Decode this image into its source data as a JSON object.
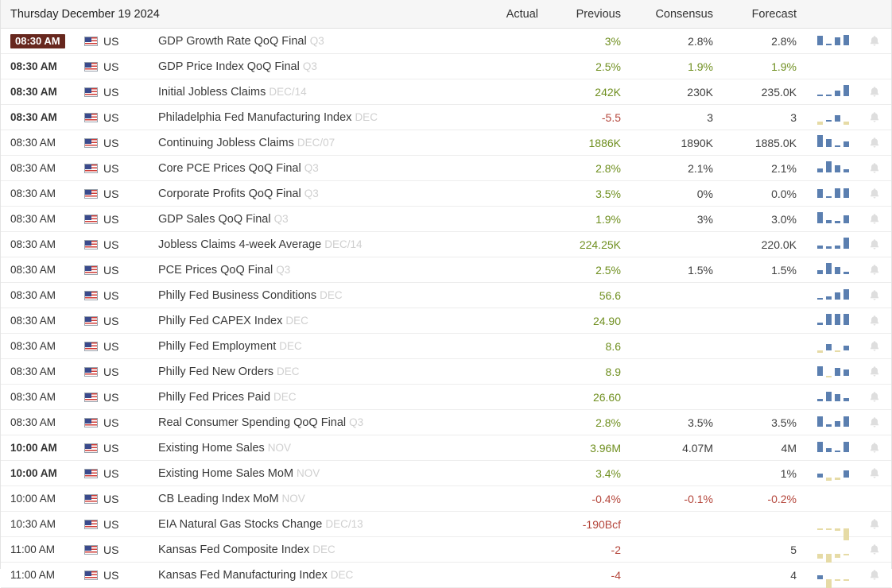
{
  "header": {
    "date": "Thursday December 19 2024",
    "columns": {
      "actual": "Actual",
      "previous": "Previous",
      "consensus": "Consensus",
      "forecast": "Forecast"
    }
  },
  "colors": {
    "positive": "#6f8f1f",
    "negative": "#b4453a",
    "neutral": "#3f3f3f",
    "period": "#cfcfcf",
    "badge_bg": "#67271e",
    "spark_up": "#5b7fb0",
    "spark_down": "#e6dba6",
    "header_bg": "#f6f6f6"
  },
  "icons": {
    "flag": "us-flag-icon",
    "bell": "bell-icon"
  },
  "country": "US",
  "rows": [
    {
      "time": "08:30 AM",
      "time_style": "badge",
      "country": "US",
      "event": "GDP Growth Rate QoQ Final",
      "period": "Q3",
      "actual": "",
      "previous": "3%",
      "consensus": "2.8%",
      "forecast": "2.8%",
      "previous_sign": "pos",
      "consensus_sign": "neu",
      "forecast_sign": "neu",
      "spark": [
        12,
        2,
        10,
        13
      ],
      "spark_dir": [
        "up",
        "up",
        "up",
        "up"
      ],
      "has_bell": true
    },
    {
      "time": "08:30 AM",
      "time_style": "bold",
      "country": "US",
      "event": "GDP Price Index QoQ Final",
      "period": "Q3",
      "actual": "",
      "previous": "2.5%",
      "consensus": "1.9%",
      "forecast": "1.9%",
      "previous_sign": "pos",
      "consensus_sign": "pos",
      "forecast_sign": "pos",
      "spark": [],
      "spark_dir": [],
      "has_bell": false
    },
    {
      "time": "08:30 AM",
      "time_style": "bold",
      "country": "US",
      "event": "Initial Jobless Claims",
      "period": "DEC/14",
      "actual": "",
      "previous": "242K",
      "consensus": "230K",
      "forecast": "235.0K",
      "previous_sign": "pos",
      "consensus_sign": "neu",
      "forecast_sign": "neu",
      "spark": [
        2,
        2,
        7,
        14
      ],
      "spark_dir": [
        "up",
        "up",
        "up",
        "up"
      ],
      "has_bell": true
    },
    {
      "time": "08:30 AM",
      "time_style": "bold",
      "country": "US",
      "event": "Philadelphia Fed Manufacturing Index",
      "period": "DEC",
      "actual": "",
      "previous": "-5.5",
      "consensus": "3",
      "forecast": "3",
      "previous_sign": "neg",
      "consensus_sign": "neu",
      "forecast_sign": "neu",
      "spark": [
        4,
        2,
        8,
        4
      ],
      "spark_dir": [
        "down",
        "up",
        "up",
        "down"
      ],
      "has_bell": true
    },
    {
      "time": "08:30 AM",
      "time_style": "normal",
      "country": "US",
      "event": "Continuing Jobless Claims",
      "period": "DEC/07",
      "actual": "",
      "previous": "1886K",
      "consensus": "1890K",
      "forecast": "1885.0K",
      "previous_sign": "pos",
      "consensus_sign": "neu",
      "forecast_sign": "neu",
      "spark": [
        15,
        10,
        2,
        7
      ],
      "spark_dir": [
        "up",
        "up",
        "up",
        "up"
      ],
      "has_bell": true
    },
    {
      "time": "08:30 AM",
      "time_style": "normal",
      "country": "US",
      "event": "Core PCE Prices QoQ Final",
      "period": "Q3",
      "actual": "",
      "previous": "2.8%",
      "consensus": "2.1%",
      "forecast": "2.1%",
      "previous_sign": "pos",
      "consensus_sign": "neu",
      "forecast_sign": "neu",
      "spark": [
        5,
        14,
        9,
        4
      ],
      "spark_dir": [
        "up",
        "up",
        "up",
        "up"
      ],
      "has_bell": true
    },
    {
      "time": "08:30 AM",
      "time_style": "normal",
      "country": "US",
      "event": "Corporate Profits QoQ Final",
      "period": "Q3",
      "actual": "",
      "previous": "3.5%",
      "consensus": "0%",
      "forecast": "0.0%",
      "previous_sign": "pos",
      "consensus_sign": "neu",
      "forecast_sign": "neu",
      "spark": [
        11,
        2,
        12,
        12
      ],
      "spark_dir": [
        "up",
        "up",
        "up",
        "up"
      ],
      "has_bell": true
    },
    {
      "time": "08:30 AM",
      "time_style": "normal",
      "country": "US",
      "event": "GDP Sales QoQ Final",
      "period": "Q3",
      "actual": "",
      "previous": "1.9%",
      "consensus": "3%",
      "forecast": "3.0%",
      "previous_sign": "pos",
      "consensus_sign": "neu",
      "forecast_sign": "neu",
      "spark": [
        14,
        4,
        3,
        10
      ],
      "spark_dir": [
        "up",
        "up",
        "up",
        "up"
      ],
      "has_bell": true
    },
    {
      "time": "08:30 AM",
      "time_style": "normal",
      "country": "US",
      "event": "Jobless Claims 4-week Average",
      "period": "DEC/14",
      "actual": "",
      "previous": "224.25K",
      "consensus": "",
      "forecast": "220.0K",
      "previous_sign": "pos",
      "consensus_sign": "neu",
      "forecast_sign": "neu",
      "spark": [
        4,
        3,
        4,
        14
      ],
      "spark_dir": [
        "up",
        "up",
        "up",
        "up"
      ],
      "has_bell": true
    },
    {
      "time": "08:30 AM",
      "time_style": "normal",
      "country": "US",
      "event": "PCE Prices QoQ Final",
      "period": "Q3",
      "actual": "",
      "previous": "2.5%",
      "consensus": "1.5%",
      "forecast": "1.5%",
      "previous_sign": "pos",
      "consensus_sign": "neu",
      "forecast_sign": "neu",
      "spark": [
        5,
        14,
        9,
        3
      ],
      "spark_dir": [
        "up",
        "up",
        "up",
        "up"
      ],
      "has_bell": true
    },
    {
      "time": "08:30 AM",
      "time_style": "normal",
      "country": "US",
      "event": "Philly Fed Business Conditions",
      "period": "DEC",
      "actual": "",
      "previous": "56.6",
      "consensus": "",
      "forecast": "",
      "previous_sign": "pos",
      "consensus_sign": "neu",
      "forecast_sign": "neu",
      "spark": [
        2,
        4,
        9,
        13
      ],
      "spark_dir": [
        "up",
        "up",
        "up",
        "up"
      ],
      "has_bell": true
    },
    {
      "time": "08:30 AM",
      "time_style": "normal",
      "country": "US",
      "event": "Philly Fed CAPEX Index",
      "period": "DEC",
      "actual": "",
      "previous": "24.90",
      "consensus": "",
      "forecast": "",
      "previous_sign": "pos",
      "consensus_sign": "neu",
      "forecast_sign": "neu",
      "spark": [
        3,
        14,
        14,
        14
      ],
      "spark_dir": [
        "up",
        "up",
        "up",
        "up"
      ],
      "has_bell": true
    },
    {
      "time": "08:30 AM",
      "time_style": "normal",
      "country": "US",
      "event": "Philly Fed Employment",
      "period": "DEC",
      "actual": "",
      "previous": "8.6",
      "consensus": "",
      "forecast": "",
      "previous_sign": "pos",
      "consensus_sign": "neu",
      "forecast_sign": "neu",
      "spark": [
        3,
        8,
        2,
        6
      ],
      "spark_dir": [
        "down",
        "up",
        "down",
        "up"
      ],
      "has_bell": true
    },
    {
      "time": "08:30 AM",
      "time_style": "normal",
      "country": "US",
      "event": "Philly Fed New Orders",
      "period": "DEC",
      "actual": "",
      "previous": "8.9",
      "consensus": "",
      "forecast": "",
      "previous_sign": "pos",
      "consensus_sign": "neu",
      "forecast_sign": "neu",
      "spark": [
        12,
        2,
        10,
        8
      ],
      "spark_dir": [
        "up",
        "down",
        "up",
        "up"
      ],
      "has_bell": true
    },
    {
      "time": "08:30 AM",
      "time_style": "normal",
      "country": "US",
      "event": "Philly Fed Prices Paid",
      "period": "DEC",
      "actual": "",
      "previous": "26.60",
      "consensus": "",
      "forecast": "",
      "previous_sign": "pos",
      "consensus_sign": "neu",
      "forecast_sign": "neu",
      "spark": [
        3,
        12,
        9,
        4
      ],
      "spark_dir": [
        "up",
        "up",
        "up",
        "up"
      ],
      "has_bell": true
    },
    {
      "time": "08:30 AM",
      "time_style": "normal",
      "country": "US",
      "event": "Real Consumer Spending QoQ Final",
      "period": "Q3",
      "actual": "",
      "previous": "2.8%",
      "consensus": "3.5%",
      "forecast": "3.5%",
      "previous_sign": "pos",
      "consensus_sign": "neu",
      "forecast_sign": "neu",
      "spark": [
        13,
        3,
        7,
        13
      ],
      "spark_dir": [
        "up",
        "up",
        "up",
        "up"
      ],
      "has_bell": true
    },
    {
      "time": "10:00 AM",
      "time_style": "bold",
      "country": "US",
      "event": "Existing Home Sales",
      "period": "NOV",
      "actual": "",
      "previous": "3.96M",
      "consensus": "4.07M",
      "forecast": "4M",
      "previous_sign": "pos",
      "consensus_sign": "neu",
      "forecast_sign": "neu",
      "spark": [
        13,
        5,
        2,
        13
      ],
      "spark_dir": [
        "up",
        "up",
        "up",
        "up"
      ],
      "has_bell": true
    },
    {
      "time": "10:00 AM",
      "time_style": "bold",
      "country": "US",
      "event": "Existing Home Sales MoM",
      "period": "NOV",
      "actual": "",
      "previous": "3.4%",
      "consensus": "",
      "forecast": "1%",
      "previous_sign": "pos",
      "consensus_sign": "neu",
      "forecast_sign": "neu",
      "spark": [
        5,
        4,
        3,
        9
      ],
      "spark_dir": [
        "up",
        "down",
        "down",
        "up"
      ],
      "has_bell": true
    },
    {
      "time": "10:00 AM",
      "time_style": "normal",
      "country": "US",
      "event": "CB Leading Index MoM",
      "period": "NOV",
      "actual": "",
      "previous": "-0.4%",
      "consensus": "-0.1%",
      "forecast": "-0.2%",
      "previous_sign": "neg",
      "consensus_sign": "neg",
      "forecast_sign": "neg",
      "spark": [],
      "spark_dir": [],
      "has_bell": false
    },
    {
      "time": "10:30 AM",
      "time_style": "normal",
      "country": "US",
      "event": "EIA Natural Gas Stocks Change",
      "period": "DEC/13",
      "actual": "",
      "previous": "-190Bcf",
      "consensus": "",
      "forecast": "",
      "previous_sign": "neg",
      "consensus_sign": "neu",
      "forecast_sign": "neu",
      "spark": [
        2,
        2,
        3,
        15
      ],
      "spark_dir": [
        "down",
        "down",
        "down",
        "down"
      ],
      "has_bell": true
    },
    {
      "time": "11:00 AM",
      "time_style": "normal",
      "country": "US",
      "event": "Kansas Fed Composite Index",
      "period": "DEC",
      "actual": "",
      "previous": "-2",
      "consensus": "",
      "forecast": "5",
      "previous_sign": "neg",
      "consensus_sign": "neu",
      "forecast_sign": "neu",
      "spark": [
        6,
        11,
        5,
        2
      ],
      "spark_dir": [
        "down",
        "down",
        "down",
        "down"
      ],
      "has_bell": true
    },
    {
      "time": "11:00 AM",
      "time_style": "normal",
      "country": "US",
      "event": "Kansas Fed Manufacturing Index",
      "period": "DEC",
      "actual": "",
      "previous": "-4",
      "consensus": "",
      "forecast": "4",
      "previous_sign": "neg",
      "consensus_sign": "neu",
      "forecast_sign": "neu",
      "spark": [
        5,
        11,
        0,
        2
      ],
      "spark_dir": [
        "up",
        "down",
        "down",
        "down"
      ],
      "has_bell": true
    }
  ]
}
